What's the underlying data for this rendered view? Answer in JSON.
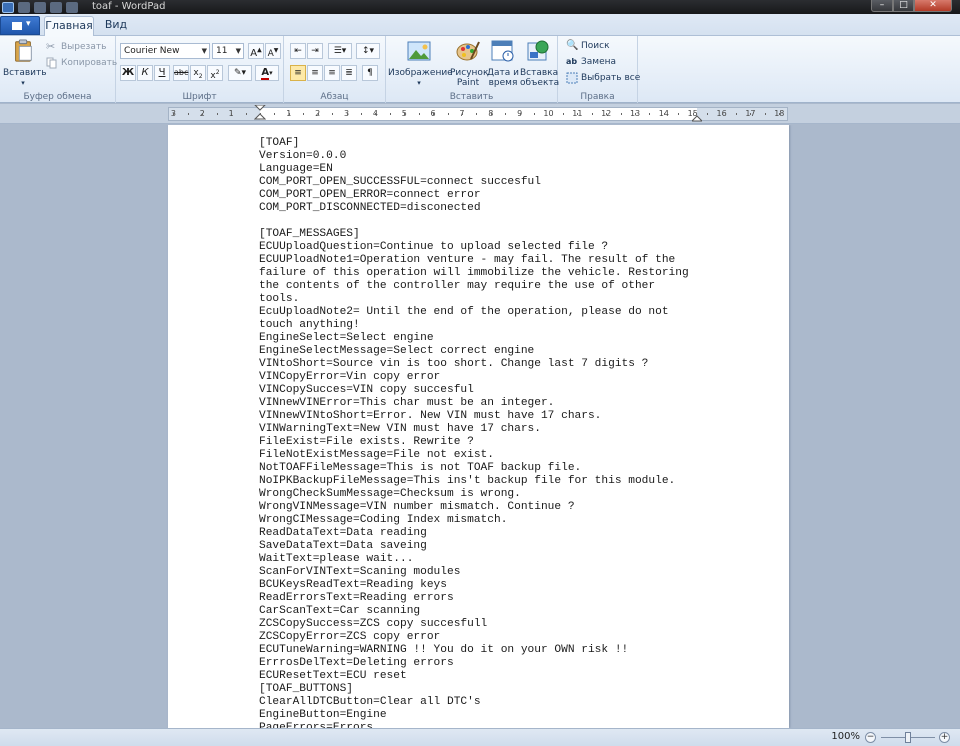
{
  "window": {
    "title": "toaf - WordPad"
  },
  "tabs": [
    {
      "label": "Главная"
    },
    {
      "label": "Вид"
    }
  ],
  "ribbon": {
    "clipboard": {
      "paste_label": "Вставить",
      "cut_label": "Вырезать",
      "copy_label": "Копировать",
      "group_label": "Буфер обмена"
    },
    "font": {
      "family": "Courier New",
      "size": "11",
      "group_label": "Шрифт"
    },
    "paragraph": {
      "group_label": "Абзац"
    },
    "insert": {
      "picture_label": "Изображение",
      "paint_label_1": "Рисунок",
      "paint_label_2": "Paint",
      "datetime_label_1": "Дата и",
      "datetime_label_2": "время",
      "object_label_1": "Вставка",
      "object_label_2": "объекта",
      "group_label": "Вставить"
    },
    "editing": {
      "find_label": "Поиск",
      "replace_label": "Замена",
      "select_all_label": "Выбрать все",
      "group_label": "Правка"
    }
  },
  "ruler": {
    "labels": [
      "3",
      "2",
      "1",
      "1",
      "2",
      "3",
      "4",
      "5",
      "6",
      "7",
      "8",
      "9",
      "10",
      "11",
      "12",
      "13",
      "14",
      "15",
      "16",
      "17",
      "18"
    ]
  },
  "document": {
    "lines": [
      "[TOAF]",
      "Version=0.0.0",
      "Language=EN",
      "COM_PORT_OPEN_SUCCESSFUL=connect succesful",
      "COM_PORT_OPEN_ERROR=connect error",
      "COM_PORT_DISCONNECTED=disconected",
      "",
      "[TOAF_MESSAGES]",
      "ECUUploadQuestion=Continue to upload selected file ?",
      "ECUUPloadNote1=Operation venture - may fail. The result of the",
      "failure of this operation will immobilize the vehicle. Restoring",
      "the contents of the controller may require the use of other",
      "tools.",
      "EcuUploadNote2= Until the end of the operation, please do not",
      "touch anything!",
      "EngineSelect=Select engine",
      "EngineSelectMessage=Select correct engine",
      "VINtoShort=Source vin is too short. Change last 7 digits ?",
      "VINCopyError=Vin copy error",
      "VINCopySucces=VIN copy succesful",
      "VINnewVINError=This char must be an integer.",
      "VINnewVINtoShort=Error. New VIN must have 17 chars.",
      "VINWarningText=New VIN must have 17 chars.",
      "FileExist=File exists. Rewrite ?",
      "FileNotExistMessage=File not exist.",
      "NotTOAFFileMessage=This is not TOAF backup file.",
      "NoIPKBackupFileMessage=This ins't backup file for this module.",
      "WrongCheckSumMessage=Checksum is wrong.",
      "WrongVINMessage=VIN number mismatch. Continue ?",
      "WrongCIMessage=Coding Index mismatch.",
      "ReadDataText=Data reading",
      "SaveDataText=Data saveing",
      "WaitText=please wait...",
      "ScanForVINText=Scaning modules",
      "BCUKeysReadText=Reading keys",
      "ReadErrorsText=Reading errors",
      "CarScanText=Car scanning",
      "ZCSCopySuccess=ZCS copy succesfull",
      "ZCSCopyError=ZCS copy error",
      "ECUTuneWarning=WARNING !! You do it on your OWN risk !!",
      "ErrrosDelText=Deleting errors",
      "ECUResetText=ECU reset",
      "[TOAF_BUTTONS]",
      "ClearAllDTCButton=Clear all DTC's",
      "EngineButton=Engine",
      "PageErrors=Errors"
    ]
  },
  "statusbar": {
    "zoom": "100%"
  },
  "colors": {
    "ribbon_bg": "#f5f9fd",
    "workspace_bg": "#abb9cc",
    "selected_align": "#fde9a8"
  }
}
